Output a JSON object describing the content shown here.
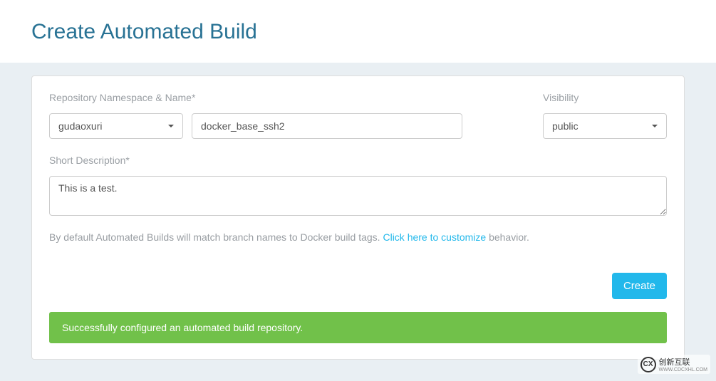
{
  "page": {
    "title": "Create Automated Build"
  },
  "form": {
    "namespace_label": "Repository Namespace & Name*",
    "namespace_value": "gudaoxuri",
    "repo_name_value": "docker_base_ssh2",
    "visibility_label": "Visibility",
    "visibility_value": "public",
    "description_label": "Short Description*",
    "description_value": "This is a test."
  },
  "info": {
    "prefix_text": "By default Automated Builds will match branch names to Docker build tags. ",
    "link_text": "Click here to customize",
    "suffix_text": " behavior."
  },
  "buttons": {
    "create_label": "Create"
  },
  "alert": {
    "success_text": "Successfully configured an automated build repository."
  },
  "watermark": {
    "brand": "创新互联",
    "sub": "WWW.CDCXHL.COM"
  }
}
